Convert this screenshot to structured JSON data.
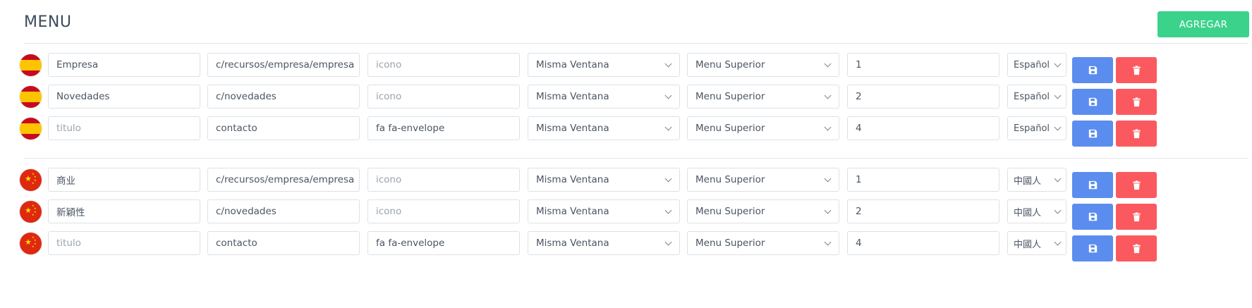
{
  "header": {
    "title": "MENU",
    "add_label": "AGREGAR"
  },
  "colors": {
    "add": "#3bd28c",
    "save": "#5b8def",
    "delete": "#fa5a5f"
  },
  "groups": [
    {
      "flag": "spain-flag",
      "rows": [
        {
          "name": "Empresa",
          "name_placeholder": "titulo",
          "link": "c/recursos/empresa/empresa",
          "icon": "",
          "icon_placeholder": "icono",
          "target": "Misma Ventana",
          "position": "Menu Superior",
          "order": "1",
          "language": "Español"
        },
        {
          "name": "Novedades",
          "name_placeholder": "titulo",
          "link": "c/novedades",
          "icon": "",
          "icon_placeholder": "icono",
          "target": "Misma Ventana",
          "position": "Menu Superior",
          "order": "2",
          "language": "Español"
        },
        {
          "name": "",
          "name_placeholder": "titulo",
          "link": "contacto",
          "icon": "fa fa-envelope",
          "icon_placeholder": "icono",
          "target": "Misma Ventana",
          "position": "Menu Superior",
          "order": "4",
          "language": "Español"
        }
      ]
    },
    {
      "flag": "china-flag",
      "rows": [
        {
          "name": "商业",
          "name_placeholder": "titulo",
          "link": "c/recursos/empresa/empresa",
          "icon": "",
          "icon_placeholder": "icono",
          "target": "Misma Ventana",
          "position": "Menu Superior",
          "order": "1",
          "language": "中國人"
        },
        {
          "name": "新穎性",
          "name_placeholder": "titulo",
          "link": "c/novedades",
          "icon": "",
          "icon_placeholder": "icono",
          "target": "Misma Ventana",
          "position": "Menu Superior",
          "order": "2",
          "language": "中國人"
        },
        {
          "name": "",
          "name_placeholder": "titulo",
          "link": "contacto",
          "icon": "fa fa-envelope",
          "icon_placeholder": "icono",
          "target": "Misma Ventana",
          "position": "Menu Superior",
          "order": "4",
          "language": "中國人"
        }
      ]
    }
  ],
  "icons": {
    "save": "floppy-disk-icon",
    "delete": "trash-icon"
  }
}
